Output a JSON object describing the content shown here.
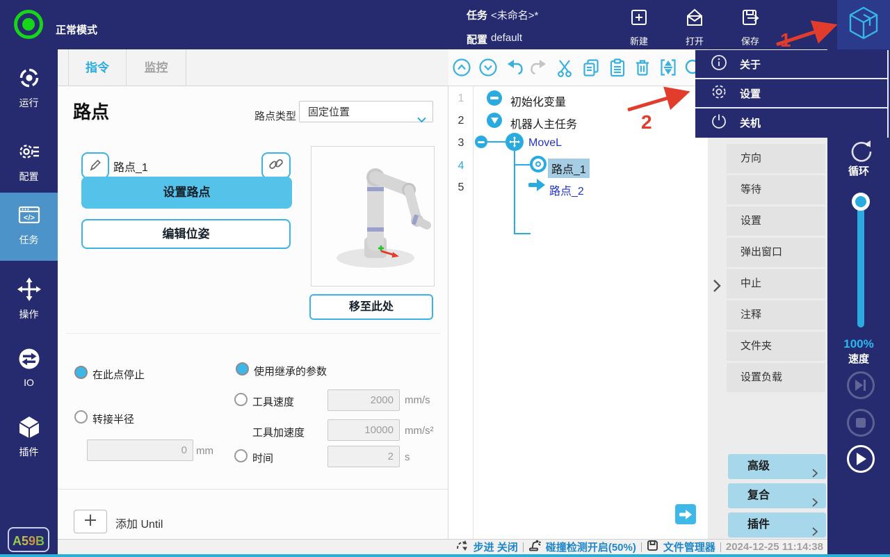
{
  "topbar": {
    "mode": "正常模式",
    "task_label": "任务",
    "task_value": "<未命名>*",
    "config_label": "配置",
    "config_value": "default",
    "new": "新建",
    "open": "打开",
    "save": "保存"
  },
  "annotations": {
    "step1": "1",
    "step2": "2"
  },
  "sidebar": {
    "items": [
      {
        "label": "运行"
      },
      {
        "label": "配置"
      },
      {
        "label": "任务"
      },
      {
        "label": "操作"
      },
      {
        "label": "IO"
      },
      {
        "label": "插件"
      }
    ],
    "badge": "A59B"
  },
  "tabs": {
    "command": "指令",
    "monitor": "监控"
  },
  "waypoint": {
    "title": "路点",
    "type_label": "路点类型",
    "type_value": "固定位置",
    "name": "路点_1",
    "set_btn": "设置路点",
    "edit_btn": "编辑位姿",
    "move_btn": "移至此处",
    "stop_label": "在此点停止",
    "blend_label": "转接半径",
    "blend_value": "0",
    "blend_unit": "mm",
    "inherit_label": "使用继承的参数",
    "speed_label": "工具速度",
    "speed_value": "2000",
    "speed_unit": "mm/s",
    "accel_label": "工具加速度",
    "accel_value": "10000",
    "accel_unit": "mm/s²",
    "time_label": "时间",
    "time_value": "2",
    "time_unit": "s",
    "add_until": "添加 Until"
  },
  "tree": {
    "rows": [
      {
        "num": "1",
        "label": "初始化变量"
      },
      {
        "num": "2",
        "label": "机器人主任务"
      },
      {
        "num": "3",
        "label": "MoveL"
      },
      {
        "num": "4",
        "label": "路点_1"
      },
      {
        "num": "5",
        "label": "路点_2"
      }
    ]
  },
  "menu": {
    "about": "关于",
    "settings": "设置",
    "shutdown": "关机"
  },
  "commands": {
    "items": [
      "方向",
      "等待",
      "设置",
      "弹出窗口",
      "中止",
      "注释",
      "文件夹",
      "设置负载"
    ],
    "groups": [
      "高级",
      "复合",
      "插件"
    ]
  },
  "rail": {
    "loop": "循环",
    "speed_value": "100%",
    "speed_label": "速度"
  },
  "statusbar": {
    "step": "步进 关闭",
    "collision": "碰撞检测开启(50%)",
    "files": "文件管理器",
    "time": "2024-12-25 11:14:38"
  },
  "colors": {
    "accent": "#29abe2",
    "navy": "#262b6f",
    "active_item": "#4b93c9",
    "annotation": "#e23c2c",
    "status_green": "#17d517"
  }
}
